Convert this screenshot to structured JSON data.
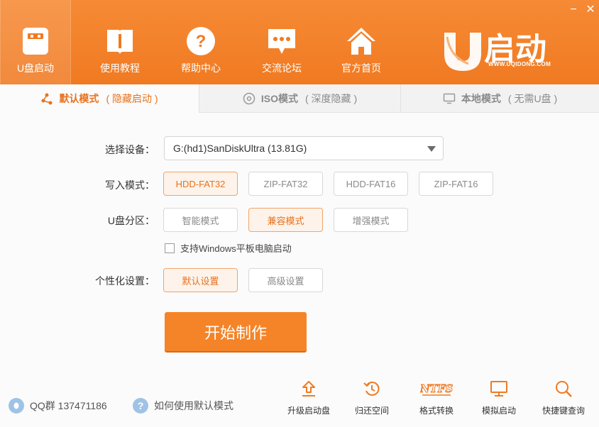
{
  "window": {
    "minimize_glyph": "−",
    "close_glyph": "✕"
  },
  "nav": [
    {
      "label": "U盘启动",
      "icon": "usb-drive-icon"
    },
    {
      "label": "使用教程",
      "icon": "book-icon"
    },
    {
      "label": "帮助中心",
      "icon": "question-icon"
    },
    {
      "label": "交流论坛",
      "icon": "chat-bubble-icon"
    },
    {
      "label": "官方首页",
      "icon": "home-icon"
    }
  ],
  "brand": {
    "logo_text": "U启动",
    "url": "WWW.UQIDONG.COM"
  },
  "tabs": [
    {
      "title": "默认模式",
      "sub": "( 隐藏启动 )",
      "icon": "share-nodes-icon"
    },
    {
      "title": "ISO模式",
      "sub": "( 深度隐藏 )",
      "icon": "disc-icon"
    },
    {
      "title": "本地模式",
      "sub": "( 无需U盘 )",
      "icon": "monitor-icon"
    }
  ],
  "form": {
    "device_label": "选择设备：",
    "device_value": "G:(hd1)SanDiskUltra (13.81G)",
    "write_mode_label": "写入模式：",
    "write_modes": [
      "HDD-FAT32",
      "ZIP-FAT32",
      "HDD-FAT16",
      "ZIP-FAT16"
    ],
    "write_mode_selected": "HDD-FAT32",
    "partition_label": "U盘分区：",
    "partitions": [
      "智能模式",
      "兼容模式",
      "增强模式"
    ],
    "partition_selected": "兼容模式",
    "checkbox_label": "支持Windows平板电脑启动",
    "checkbox_checked": false,
    "personal_label": "个性化设置：",
    "personal_options": [
      "默认设置",
      "高级设置"
    ],
    "personal_selected": "默认设置",
    "start_button": "开始制作"
  },
  "footer": {
    "qq_text": "QQ群 137471186",
    "help_text": "如何使用默认模式",
    "tools": [
      {
        "label": "升级启动盘",
        "icon": "upload-arrow-icon"
      },
      {
        "label": "归还空间",
        "icon": "restore-icon"
      },
      {
        "label": "格式转换",
        "icon": "ntfs-icon",
        "icon_text": "NTFS"
      },
      {
        "label": "模拟启动",
        "icon": "monitor-icon"
      },
      {
        "label": "快捷键查询",
        "icon": "search-icon"
      }
    ]
  },
  "colors": {
    "accent": "#f58428",
    "header": "#f07a22",
    "selected_bg": "#fdf3ea"
  }
}
